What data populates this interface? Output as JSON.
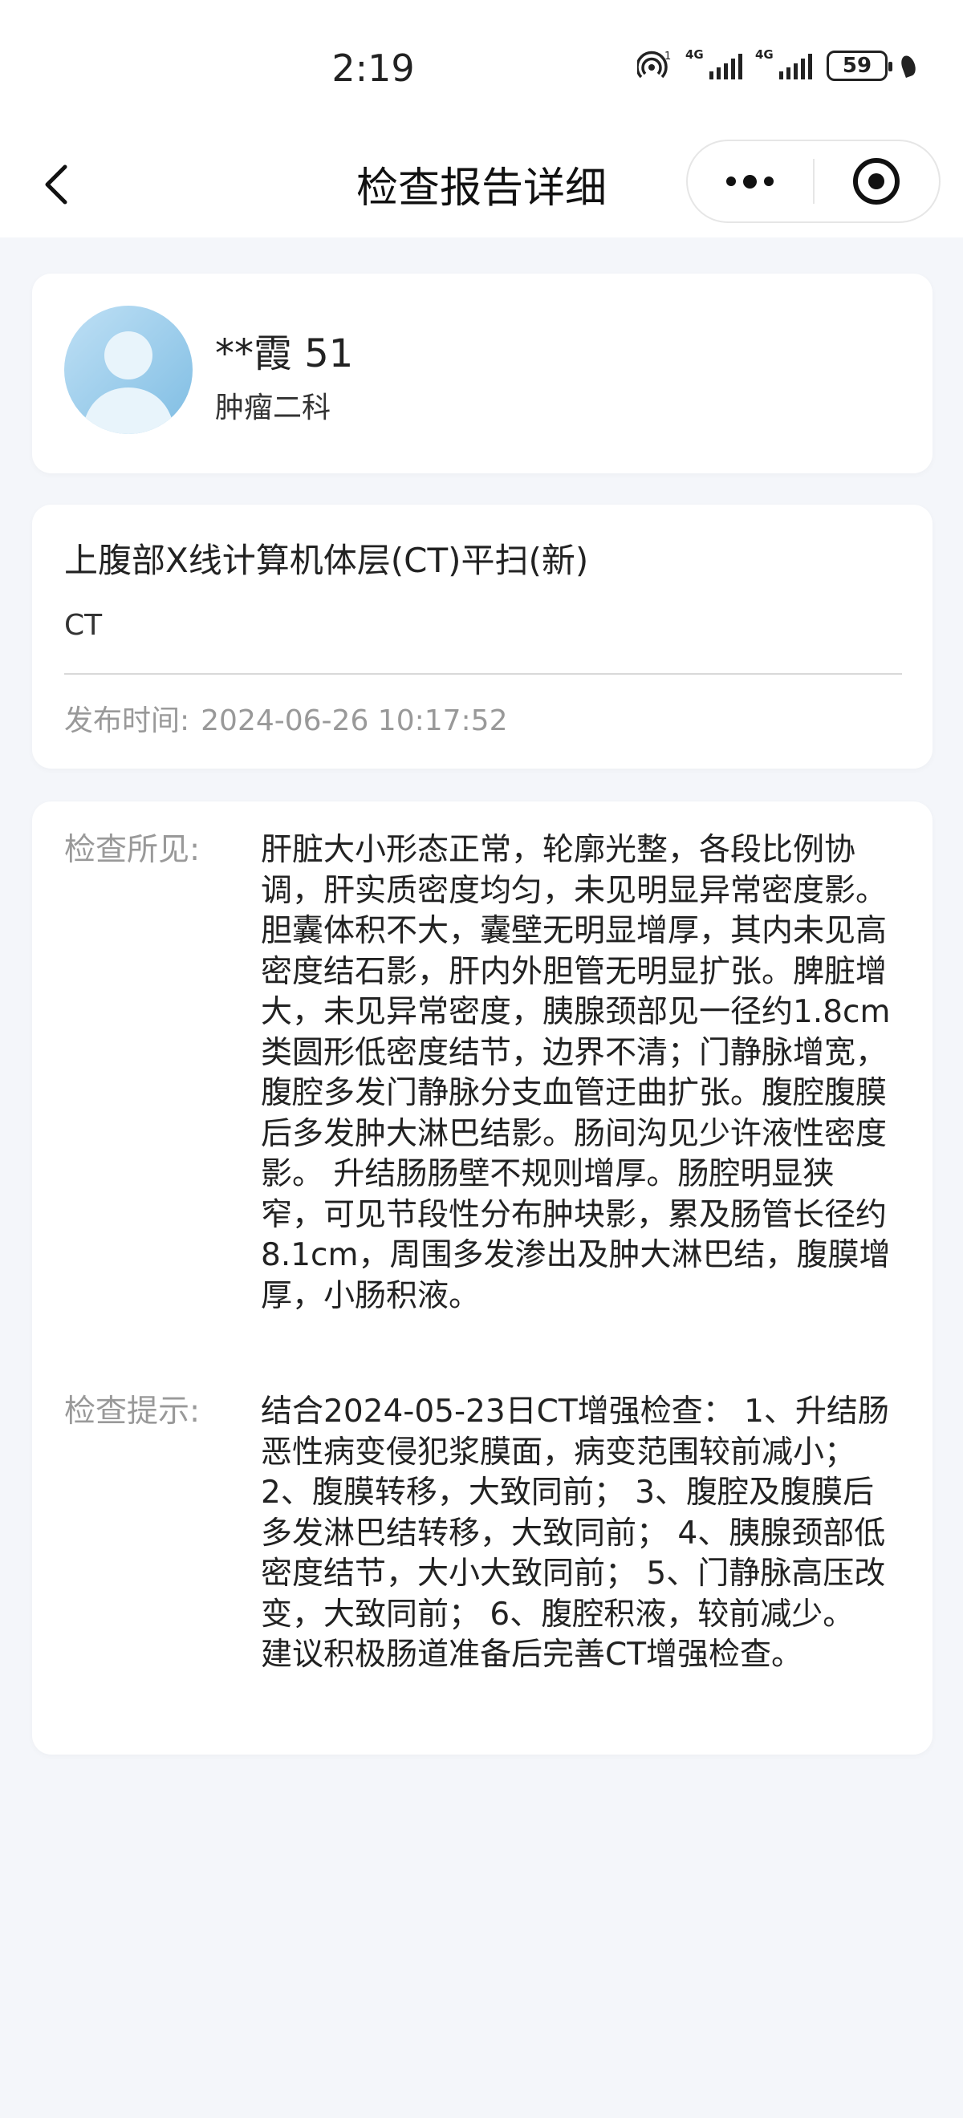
{
  "status_bar": {
    "time": "2:19",
    "network_1": "4G",
    "network_2": "4G",
    "battery": "59"
  },
  "nav": {
    "title": "检查报告详细"
  },
  "patient": {
    "name": "**霞 51",
    "department": "肿瘤二科"
  },
  "report": {
    "title": "上腹部X线计算机体层(CT)平扫(新)",
    "type": "CT",
    "publish_label": "发布时间:",
    "publish_time": "2024-06-26 10:17:52"
  },
  "findings": {
    "label": "检查所见:",
    "text": "肝脏大小形态正常，轮廓光整，各段比例协调，肝实质密度均匀，未见明显异常密度影。胆囊体积不大，囊壁无明显增厚，其内未见高密度结石影，肝内外胆管无明显扩张。脾脏增大，未见异常密度，胰腺颈部见一径约1.8cm类圆形低密度结节，边界不清；门静脉增宽，腹腔多发门静脉分支血管迂曲扩张。腹腔腹膜后多发肿大淋巴结影。肠间沟见少许液性密度影。 升结肠肠壁不规则增厚。肠腔明显狭窄，可见节段性分布肿块影，累及肠管长径约8.1cm，周围多发渗出及肿大淋巴结，腹膜增厚，小肠积液。"
  },
  "impression": {
    "label": "检查提示:",
    "text": "结合2024-05-23日CT增强检查： 1、升结肠恶性病变侵犯浆膜面，病变范围较前减小； 2、腹膜转移，大致同前； 3、腹腔及腹膜后多发淋巴结转移，大致同前； 4、胰腺颈部低密度结节，大小大致同前； 5、门静脉高压改变，大致同前； 6、腹腔积液，较前减少。 建议积极肠道准备后完善CT增强检查。"
  },
  "icons": {
    "back": "chevron-left-icon",
    "more": "more-dots-icon",
    "close": "target-circle-icon",
    "avatar": "user-silhouette-icon"
  },
  "colors": {
    "page_bg": "#f4f6fa",
    "card_bg": "#ffffff",
    "label_gray": "#999999",
    "text_dark": "#222222",
    "avatar_blue": "#7fbde3"
  }
}
